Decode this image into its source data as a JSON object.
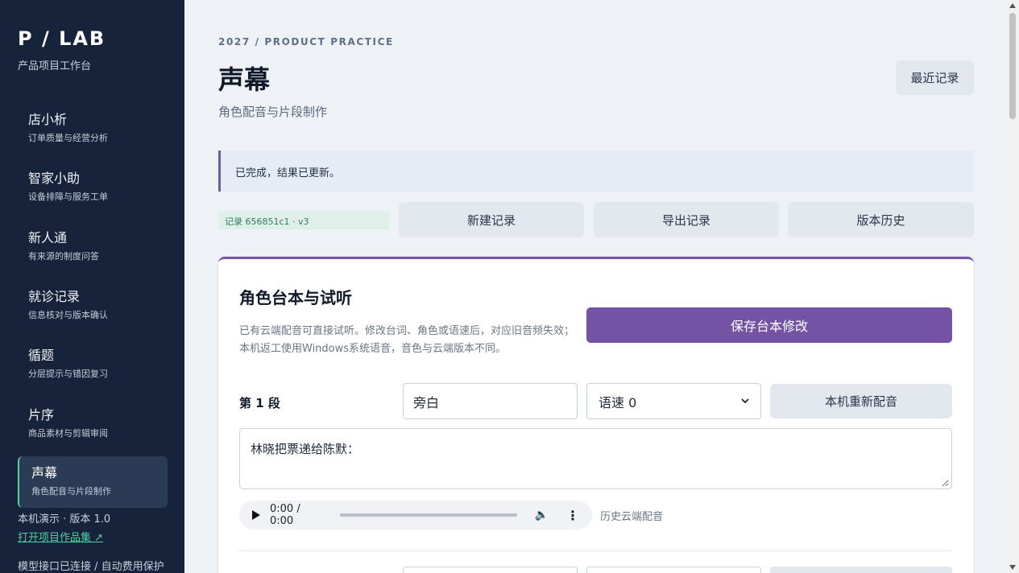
{
  "sidebar": {
    "brand": "P / LAB",
    "brand_sub": "产品项目工作台",
    "items": [
      {
        "title": "店小析",
        "sub": "订单质量与经营分析"
      },
      {
        "title": "智家小助",
        "sub": "设备排障与服务工单"
      },
      {
        "title": "新人通",
        "sub": "有来源的制度问答"
      },
      {
        "title": "就诊记录",
        "sub": "信息核对与版本确认"
      },
      {
        "title": "循题",
        "sub": "分层提示与错因复习"
      },
      {
        "title": "片序",
        "sub": "商品素材与剪辑审阅"
      },
      {
        "title": "声幕",
        "sub": "角色配音与片段制作"
      }
    ],
    "version": "本机演示 · 版本 1.0",
    "portfolio_link": "打开项目作品集 ↗",
    "status": "模型接口已连接 / 自动费用保护"
  },
  "header": {
    "eyebrow": "2027 / PRODUCT PRACTICE",
    "title": "声幕",
    "subtitle": "角色配音与片段制作",
    "recent_button": "最近记录"
  },
  "notice": "已完成，结果已更新。",
  "toolbar": {
    "record_tag": "记录 656851c1 · v3",
    "new_record": "新建记录",
    "export_record": "导出记录",
    "version_history": "版本历史"
  },
  "card": {
    "title": "角色台本与试听",
    "description": "已有云端配音可直接试听。修改台词、角色或语速后，对应旧音频失效；本机返工使用Windows系统语音，音色与云端版本不同。",
    "save_button": "保存台本修改",
    "segment": {
      "label": "第 1 段",
      "role_value": "旁白",
      "speed_value": "语速 0",
      "redub_button": "本机重新配音",
      "line_text": "林晓把票递给陈默：",
      "audio_time": "0:00 / 0:00",
      "audio_note": "历史云端配音"
    }
  },
  "colors": {
    "sidebar_bg": "#17233a",
    "accent_purple": "#7453a4",
    "accent_green": "#4fd0a5"
  }
}
